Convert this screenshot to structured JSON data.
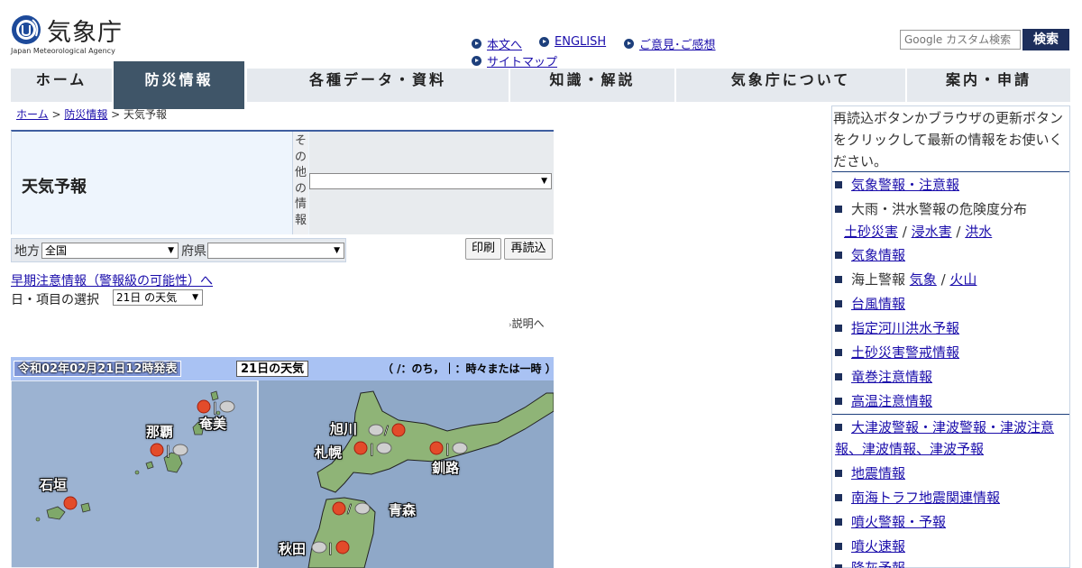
{
  "header": {
    "logo_text": "気象庁",
    "logo_subtext": "Japan Meteorological Agency",
    "links": [
      "本文へ",
      "ENGLISH",
      "ご意見･ご感想",
      "サイトマップ"
    ],
    "search_placeholder": "Google カスタム検索",
    "search_button": "検索"
  },
  "nav": [
    "ホーム",
    "防災情報",
    "各種データ・資料",
    "知識・解説",
    "気象庁について",
    "案内・申請"
  ],
  "breadcrumb": {
    "home": "ホーム",
    "sep1": " > ",
    "disaster": "防災情報",
    "sep2": " > ",
    "current": "天気予報"
  },
  "title": "天気予報",
  "other_info": {
    "label": "その他の情報",
    "value": ""
  },
  "region": {
    "label": "地方",
    "value": "全国",
    "pref_label": "府県",
    "pref_value": ""
  },
  "buttons": {
    "print": "印刷",
    "reload": "再読込"
  },
  "early_warning_link": "早期注意情報（警報級の可能性）へ",
  "day_select": {
    "label": "日・項目の選択",
    "value": "21日 の天気"
  },
  "explain_link": "説明へ",
  "map": {
    "issued": "令和02年02月21日12時発表",
    "day": "21日の天気",
    "legend": "（ /：のち，｜：時々または一時 ）",
    "cities": [
      "奄美",
      "那覇",
      "石垣",
      "旭川",
      "札幌",
      "釧路",
      "青森",
      "秋田"
    ],
    "separators": [
      "|",
      "|",
      "/",
      "|",
      "|",
      "/",
      "|"
    ]
  },
  "sidebar": {
    "note": "再読込ボタンかブラウザの更新ボタンをクリックして最新の情報をお使いください。",
    "item_warning": "気象警報・注意報",
    "item_risk": "大雨・洪水警報の危険度分布",
    "item_risk_sub": [
      "土砂災害",
      "浸水害",
      "洪水"
    ],
    "item_weather_info": "気象情報",
    "item_marine": "海上警報",
    "item_marine_sub": [
      "気象",
      "火山"
    ],
    "item_typhoon": "台風情報",
    "item_river": "指定河川洪水予報",
    "item_landslide": "土砂災害警戒情報",
    "item_tornado": "竜巻注意情報",
    "item_heat": "高温注意情報",
    "item_tsunami": "大津波警報・津波警報・津波注意報、津波情報、津波予報",
    "item_earthquake": "地震情報",
    "item_nankai": "南海トラフ地震関連情報",
    "item_volcano_warn": "噴火警報・予報",
    "item_volcano_quick": "噴火速報",
    "item_ash": "降灰予報"
  },
  "colors": {
    "nav_active": "#3f5568",
    "nav_bg": "#e5e9ee",
    "link": "#1a0dab",
    "accent": "#1d2f5c",
    "map_sea": "#9ab0cc"
  }
}
